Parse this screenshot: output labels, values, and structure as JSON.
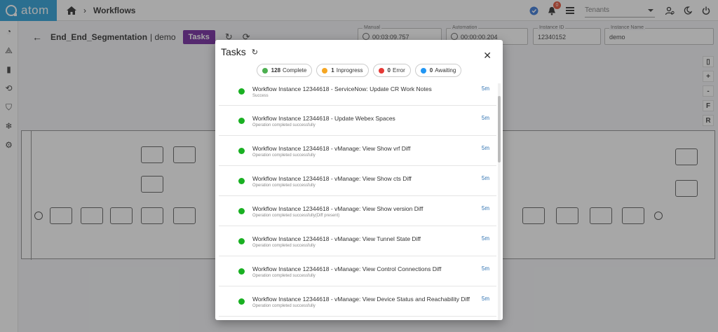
{
  "app": {
    "name": "atom"
  },
  "breadcrumb": {
    "title": "Workflows"
  },
  "topbar": {
    "notification_count": "0",
    "tenant_placeholder": "Tenants"
  },
  "page": {
    "workflow_name": "End_End_Segmentation",
    "tenant": "| demo",
    "tasks_label": "Tasks"
  },
  "fields": [
    {
      "label": "Manual",
      "value": "00:03:09.757"
    },
    {
      "label": "Automation",
      "value": "00:00:00.204"
    },
    {
      "label": "Instance ID",
      "value": "12340152"
    },
    {
      "label": "Instance Name",
      "value": "demo"
    }
  ],
  "map_controls": [
    "+",
    "-",
    "F",
    "R"
  ],
  "modal": {
    "title": "Tasks",
    "chips": [
      {
        "count": "128",
        "label": "Complete",
        "color": "#4caf50"
      },
      {
        "count": "1",
        "label": "Inprogress",
        "color": "#f5a623"
      },
      {
        "count": "0",
        "label": "Error",
        "color": "#e53935"
      },
      {
        "count": "0",
        "label": "Awaiting",
        "color": "#2196f3"
      }
    ],
    "tasks": [
      {
        "name": "Workflow Instance 12344618 - ServiceNow: Update CR Work Notes",
        "status": "Success",
        "time": "5m"
      },
      {
        "name": "Workflow Instance 12344618 - Update Webex Spaces",
        "status": "Operation completed successfully",
        "time": "5m"
      },
      {
        "name": "Workflow Instance 12344618 - vManage: View Show vrf Diff",
        "status": "Operation completed successfully",
        "time": "5m"
      },
      {
        "name": "Workflow Instance 12344618 - vManage: View Show cts Diff",
        "status": "Operation completed successfully",
        "time": "5m"
      },
      {
        "name": "Workflow Instance 12344618 - vManage: View Show version Diff",
        "status": "Operation completed successfully(Diff present)",
        "time": "5m"
      },
      {
        "name": "Workflow Instance 12344618 - vManage: View Tunnel State Diff",
        "status": "Operation completed successfully",
        "time": "5m"
      },
      {
        "name": "Workflow Instance 12344618 - vManage: View Control Connections Diff",
        "status": "Operation completed successfully",
        "time": "5m"
      },
      {
        "name": "Workflow Instance 12344618 - vManage: View Device Status and Reachability Diff",
        "status": "Operation completed successfully",
        "time": "5m"
      }
    ]
  }
}
